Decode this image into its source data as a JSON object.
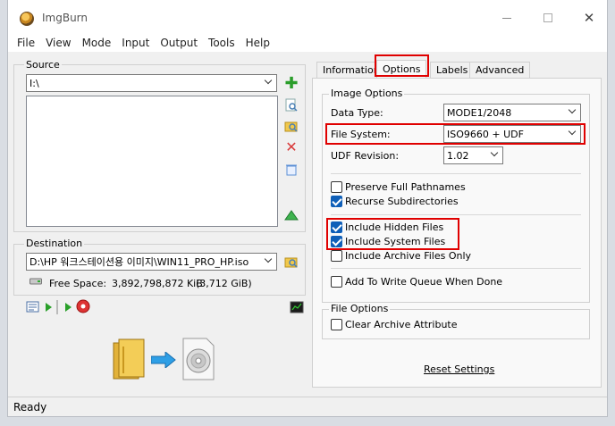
{
  "window": {
    "title": "ImgBurn"
  },
  "menu": [
    "File",
    "View",
    "Mode",
    "Input",
    "Output",
    "Tools",
    "Help"
  ],
  "source": {
    "label": "Source",
    "path": "I:\\"
  },
  "destination": {
    "label": "Destination",
    "path": "D:\\HP 워크스테이션용 이미지\\WIN11_PRO_HP.iso",
    "free_space_label": "Free Space:",
    "free_space_value": "3,892,798,872 KiB",
    "free_space_gib": "(3,712 GiB)"
  },
  "tabs": [
    "Information",
    "Options",
    "Labels",
    "Advanced"
  ],
  "active_tab": "Options",
  "image_options": {
    "label": "Image Options",
    "data_type_label": "Data Type:",
    "data_type_value": "MODE1/2048",
    "file_system_label": "File System:",
    "file_system_value": "ISO9660 + UDF",
    "udf_revision_label": "UDF Revision:",
    "udf_revision_value": "1.02",
    "preserve_full_pathnames": "Preserve Full Pathnames",
    "recurse_subdirectories": "Recurse Subdirectories",
    "include_hidden_files": "Include Hidden Files",
    "include_system_files": "Include System Files",
    "include_archive_files_only": "Include Archive Files Only",
    "add_to_write_queue": "Add To Write Queue When Done"
  },
  "file_options": {
    "label": "File Options",
    "clear_archive_attribute": "Clear Archive Attribute"
  },
  "reset_settings": "Reset Settings",
  "status": "Ready",
  "colors": {
    "accent": "#0f5fb8",
    "highlight": "#e00000"
  }
}
